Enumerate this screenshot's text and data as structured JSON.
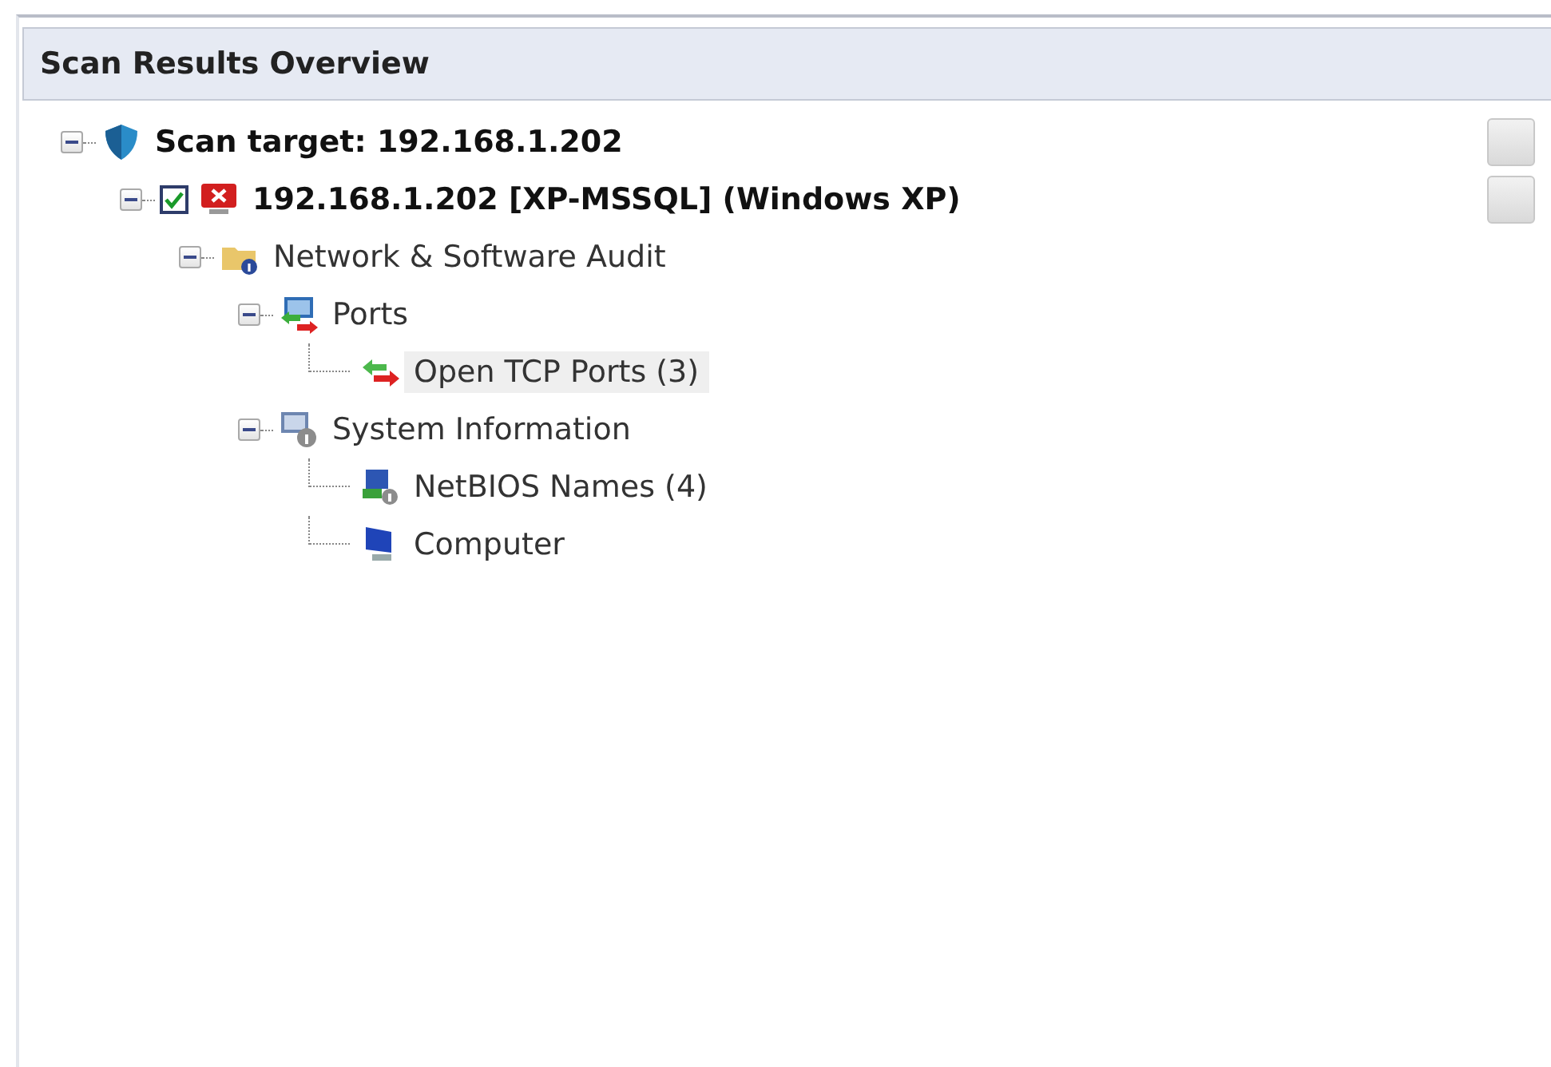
{
  "panel": {
    "title": "Scan Results Overview"
  },
  "tree": [
    {
      "kind": "target",
      "label": "Scan target: 192.168.1.202",
      "expanded": true,
      "selected": false,
      "action_box": true,
      "children": [
        {
          "kind": "host",
          "label": "192.168.1.202 [XP-MSSQL] (Windows XP)",
          "expanded": true,
          "checked": true,
          "selected": false,
          "action_box": true,
          "children": [
            {
              "kind": "audit",
              "label": "Network & Software Audit",
              "expanded": true,
              "selected": false,
              "children": [
                {
                  "kind": "ports",
                  "label": "Ports",
                  "expanded": true,
                  "selected": false,
                  "children": [
                    {
                      "kind": "tcp",
                      "label": "Open TCP Ports (3)",
                      "selected": true
                    }
                  ]
                },
                {
                  "kind": "sysinfo",
                  "label": "System Information",
                  "expanded": true,
                  "selected": false,
                  "children": [
                    {
                      "kind": "netbios",
                      "label": "NetBIOS Names (4)",
                      "selected": false
                    },
                    {
                      "kind": "computer",
                      "label": "Computer",
                      "selected": false
                    }
                  ]
                }
              ]
            }
          ]
        }
      ]
    }
  ]
}
